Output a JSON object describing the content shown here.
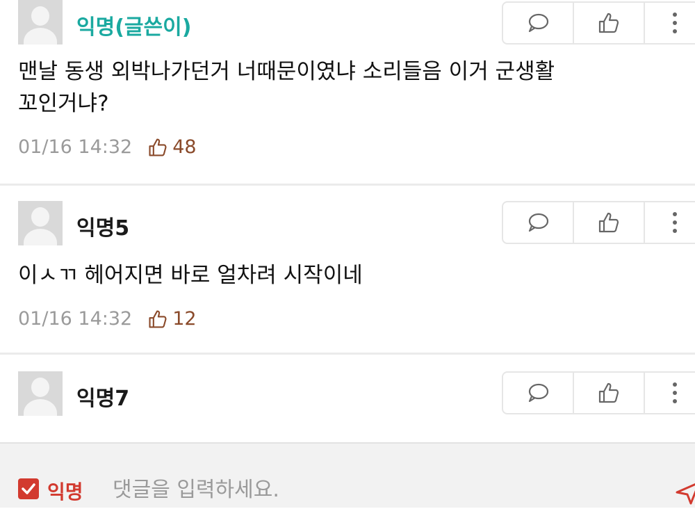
{
  "comments": [
    {
      "author": "익명(글쓴이)",
      "text_lines": [
        "맨날 동생 외박나가던거 너때문이였냐 소리들음 이거 군생활",
        "꼬인거냐?"
      ],
      "time": "01/16 14:32",
      "likes": "48"
    },
    {
      "author": "익명5",
      "text_lines": [
        "이ㅅㄲ 헤어지면 바로 얼차려 시작이네"
      ],
      "time": "01/16 14:32",
      "likes": "12"
    },
    {
      "author": "익명7"
    }
  ],
  "input_bar": {
    "anonymous_label": "익명",
    "placeholder": "댓글을 입력하세요."
  },
  "colors": {
    "writer_name": "#1aa9a0",
    "accent_red": "#d23a2f",
    "like_brown": "#8a4a2a"
  },
  "icons": {
    "reply": "speech-bubble-icon",
    "like": "thumbs-up-icon",
    "more": "vertical-dots-icon",
    "send": "send-icon"
  }
}
